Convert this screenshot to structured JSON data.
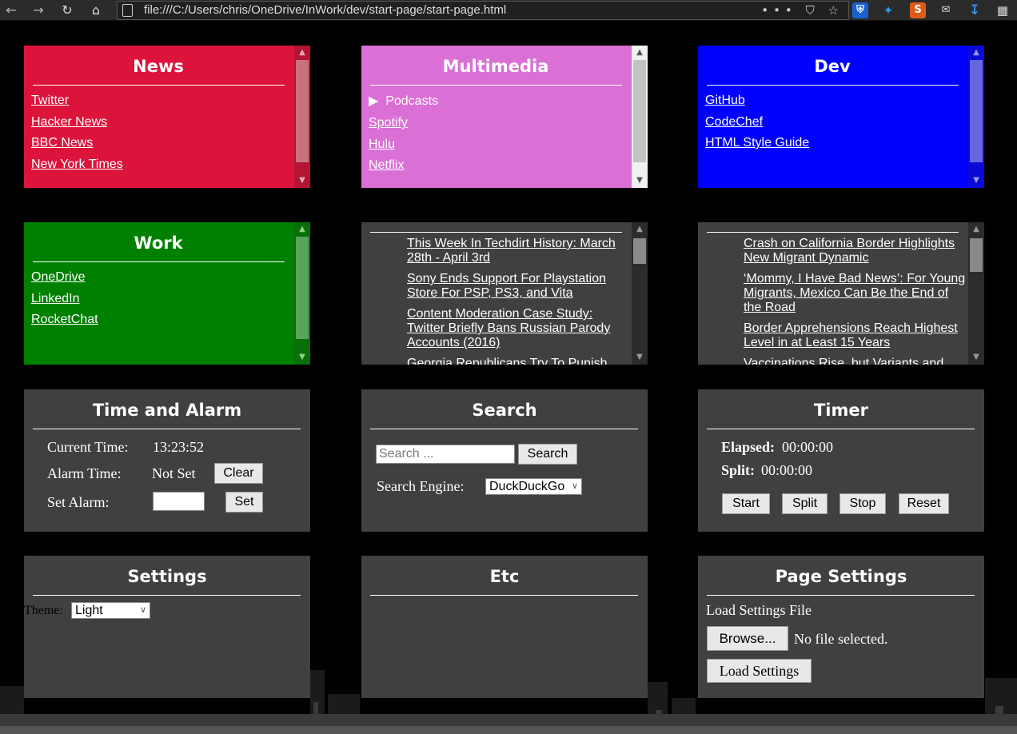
{
  "browser": {
    "url": "file:///C:/Users/chris/OneDrive/InWork/dev/start-page/start-page.html",
    "url_actions": "••• ⛉ ☆"
  },
  "news": {
    "title": "News",
    "color": "#DC143C",
    "links": [
      "Twitter",
      "Hacker News",
      "BBC News",
      "New York Times"
    ]
  },
  "multimedia": {
    "title": "Multimedia",
    "color": "#DA70D6",
    "podcasts_label": "Podcasts",
    "links": [
      "Spotify",
      "Hulu",
      "Netflix"
    ]
  },
  "dev": {
    "title": "Dev",
    "color": "#0000FF",
    "links": [
      "GitHub",
      "CodeChef",
      "HTML Style Guide"
    ]
  },
  "work": {
    "title": "Work",
    "color": "#008000",
    "links": [
      "OneDrive",
      "LinkedIn",
      "RocketChat"
    ]
  },
  "feed_left": {
    "items": [
      "This Week In Techdirt History: March 28th - April 3rd",
      "Sony Ends Support For Playstation Store For PSP, PS3, and Vita",
      "Content Moderation Case Study: Twitter Briefly Bans Russian Parody Accounts (2016)",
      "Georgia Republicans Try To Punish"
    ]
  },
  "feed_right": {
    "items": [
      "Crash on California Border Highlights New Migrant Dynamic",
      "‘Mommy, I Have Bad News’: For Young Migrants, Mexico Can Be the End of the Road",
      "Border Apprehensions Reach Highest Level in at Least 15 Years",
      "Vaccinations Rise, but Variants and"
    ]
  },
  "time_alarm": {
    "title": "Time and Alarm",
    "current_label": "Current Time:",
    "current_value": "13:23:52",
    "alarm_label": "Alarm Time:",
    "alarm_value": "Not Set",
    "clear_button": "Clear",
    "set_label": "Set Alarm:",
    "set_value": "",
    "set_button": "Set"
  },
  "search": {
    "title": "Search",
    "placeholder": "Search ...",
    "button": "Search",
    "engine_label": "Search Engine:",
    "engine_value": "DuckDuckGo"
  },
  "timer": {
    "title": "Timer",
    "elapsed_label": "Elapsed:",
    "elapsed_value": "00:00:00",
    "split_label": "Split:",
    "split_value": "00:00:00",
    "buttons": [
      "Start",
      "Split",
      "Stop",
      "Reset"
    ]
  },
  "settings": {
    "title": "Settings",
    "theme_label": "Theme:",
    "theme_value": "Light"
  },
  "etc": {
    "title": "Etc"
  },
  "page_settings": {
    "title": "Page Settings",
    "load_label": "Load Settings File",
    "browse_button": "Browse...",
    "file_status": "No file selected.",
    "load_button": "Load Settings"
  }
}
